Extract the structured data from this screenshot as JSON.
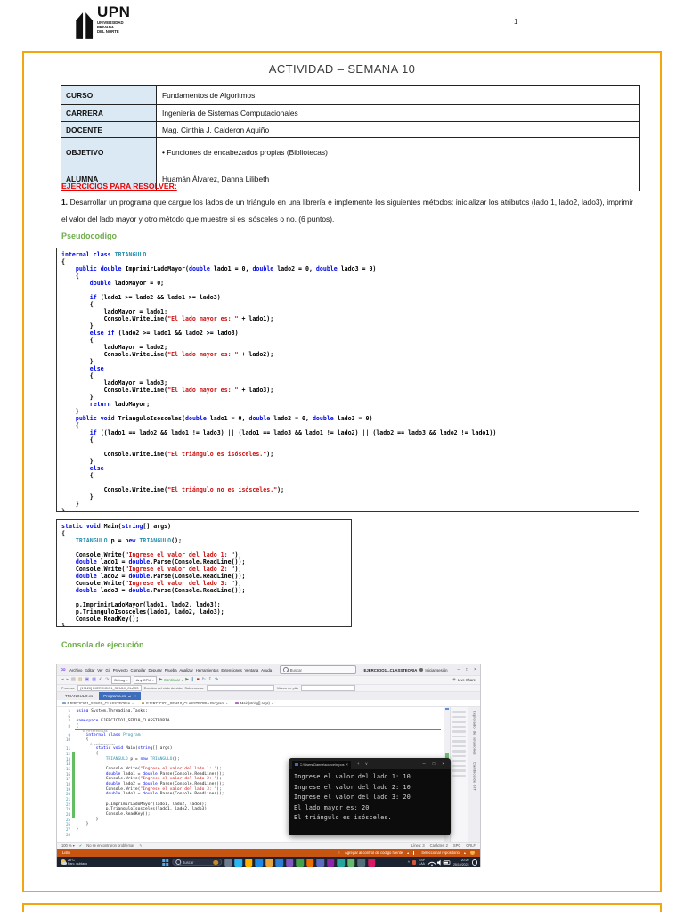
{
  "page": {
    "number": "1",
    "logo_brand": "UPN",
    "logo_sub": [
      "UNIVERSIDAD",
      "PRIVADA",
      "DEL NORTE"
    ],
    "title": "ACTIVIDAD – SEMANA 10"
  },
  "info_table": [
    {
      "label": "CURSO",
      "value": "Fundamentos de Algoritmos"
    },
    {
      "label": "CARRERA",
      "value": "Ingeniería de Sistemas Computacionales"
    },
    {
      "label": "DOCENTE",
      "value": "Mag. Cinthia J. Calderon Aquiño"
    },
    {
      "label": "OBJETIVO",
      "value": "• Funciones de encabezados propias (Bibliotecas)"
    },
    {
      "label": "ALUMNA",
      "value": "Huamán Álvarez, Danna Lilibeth"
    }
  ],
  "exercises": {
    "heading": "EJERCICIOS PARA RESOLVER:",
    "item_number": "1.",
    "item_text": " Desarrollar un programa que cargue los lados de un triángulo en una librería e implemente los siguientes métodos: inicializar los atributos (lado 1, lado2, lado3), imprimir el valor del lado mayor y otro método que muestre si es isósceles o no. (6 puntos)."
  },
  "sections": {
    "pseudocode_heading": "Pseudocodigo",
    "console_heading": "Consola de ejecución"
  },
  "code_block_1": [
    "internal class TRIANGULO",
    "{",
    "    public double ImprimirLadoMayor(double lado1 = 0, double lado2 = 0, double lado3 = 0)",
    "    {",
    "        double ladoMayor = 0;",
    "",
    "        if (lado1 >= lado2 && lado1 >= lado3)",
    "        {",
    "            ladoMayor = lado1;",
    "            Console.WriteLine(\"El lado mayor es: \" + lado1);",
    "        }",
    "        else if (lado2 >= lado1 && lado2 >= lado3)",
    "        {",
    "            ladoMayor = lado2;",
    "            Console.WriteLine(\"El lado mayor es: \" + lado2);",
    "        }",
    "        else",
    "        {",
    "            ladoMayor = lado3;",
    "            Console.WriteLine(\"El lado mayor es: \" + lado3);",
    "        }",
    "        return ladoMayor;",
    "    }",
    "    public void TrianguloIsosceles(double lado1 = 0, double lado2 = 0, double lado3 = 0)",
    "    {",
    "        if ((lado1 == lado2 && lado1 != lado3) || (lado1 == lado3 && lado1 != lado2) || (lado2 == lado3 && lado2 != lado1))",
    "        {",
    "",
    "            Console.WriteLine(\"El triángulo es isósceles.\");",
    "        }",
    "        else",
    "        {",
    "",
    "            Console.WriteLine(\"El triángulo no es isósceles.\");",
    "        }",
    "    }",
    "}"
  ],
  "code_block_2": [
    "static void Main(string[] args)",
    "{",
    "    TRIANGULO p = new TRIANGULO();",
    "",
    "    Console.Write(\"Ingrese el valor del lado 1: \");",
    "    double lado1 = double.Parse(Console.ReadLine());",
    "    Console.Write(\"Ingrese el valor del lado 2: \");",
    "    double lado2 = double.Parse(Console.ReadLine());",
    "    Console.Write(\"Ingrese el valor del lado 3: \");",
    "    double lado3 = double.Parse(Console.ReadLine());",
    "",
    "    p.ImprimirLadoMayor(lado1, lado2, lado3);",
    "    p.TrianguloIsosceles(lado1, lado2, lado3);",
    "    Console.ReadKey();",
    "}"
  ],
  "vs": {
    "menus": [
      "Archivo",
      "Editar",
      "Ver",
      "Git",
      "Proyecto",
      "Compilar",
      "Depurar",
      "Prueba",
      "Analizar",
      "Herramientas",
      "Extensiones",
      "Ventana",
      "Ayuda"
    ],
    "search_label": "Buscar",
    "solution_name": "EJERCICIO1...CLASSTEORIA",
    "sign_in": "Iniciar sesión",
    "toolbar": {
      "icons_left": [
        {
          "name": "navigate-back",
          "g": "◂",
          "c": "#8A8A92"
        },
        {
          "name": "navigate-forward",
          "g": "▸",
          "c": "#8A8A92"
        },
        {
          "name": "new-file",
          "g": "▤",
          "c": "#8A8A92"
        },
        {
          "name": "open-file",
          "g": "▥",
          "c": "#C8A254"
        },
        {
          "name": "save",
          "g": "▣",
          "c": "#7A6FF0"
        },
        {
          "name": "save-all",
          "g": "▦",
          "c": "#7A6FF0"
        },
        {
          "name": "undo",
          "g": "↶",
          "c": "#8A8A92"
        },
        {
          "name": "redo",
          "g": "↷",
          "c": "#8A8A92"
        }
      ],
      "debug_target": "Debug",
      "platform": "Any CPU",
      "continue_label": "Continuar",
      "icons_run": [
        {
          "name": "continue-play",
          "g": "▶",
          "c": "#3F9E44"
        },
        {
          "name": "break-all",
          "g": "∥",
          "c": "#3E79B4"
        },
        {
          "name": "stop-debug",
          "g": "■",
          "c": "#C0392B"
        },
        {
          "name": "restart",
          "g": "↻",
          "c": "#3E79B4"
        },
        {
          "name": "step-into",
          "g": "↧",
          "c": "#3E79B4"
        },
        {
          "name": "step-over",
          "g": "↷",
          "c": "#3E79B4"
        }
      ],
      "live_share": "Live Share"
    },
    "process_row": {
      "process_label": "Proceso:",
      "process_value": "[17120] EJERCICIO1_SEM10_CLASS",
      "lifecycle": "Eventos del ciclo de vida",
      "thread_label": "Subproceso:",
      "stack_label": "Marco de pila"
    },
    "tabs": [
      {
        "label": "TRIANGULO.cs",
        "active": false
      },
      {
        "label": "Programa.cs",
        "active": true
      }
    ],
    "breadcrumbs": [
      "EJERCICIO1_SEM10_CLASSTEORIA",
      "EJERCICIO1_SEM10_CLASSTEORIA.Program",
      "Main(string[] args)"
    ],
    "editor_lines": [
      {
        "n": "5",
        "c": "using System.Threading.Tasks;"
      },
      {
        "n": "6",
        "c": ""
      },
      {
        "n": "7",
        "c": "namespace EJERCICIO1_SEM10_CLASSTEORIA"
      },
      {
        "n": "8",
        "c": "{"
      },
      {
        "ref": "    0 referencias"
      },
      {
        "n": "9",
        "c": "    internal class Program"
      },
      {
        "n": "10",
        "c": "    {"
      },
      {
        "ref": "        0 referencias"
      },
      {
        "n": "11",
        "c": "        static void Main(string[] args)"
      },
      {
        "n": "12",
        "c": "        {",
        "g": true
      },
      {
        "n": "13",
        "c": "            TRIANGULO p = new TRIANGULO();",
        "g": true
      },
      {
        "n": "14",
        "c": "",
        "g": true
      },
      {
        "n": "15",
        "c": "            Console.Write(\"Ingrese el valor del lado 1: \");",
        "g": true
      },
      {
        "n": "16",
        "c": "            double lado1 = double.Parse(Console.ReadLine());",
        "g": true
      },
      {
        "n": "17",
        "c": "            Console.Write(\"Ingrese el valor del lado 2: \");",
        "g": true
      },
      {
        "n": "18",
        "c": "            double lado2 = double.Parse(Console.ReadLine());",
        "g": true
      },
      {
        "n": "19",
        "c": "            Console.Write(\"Ingrese el valor del lado 3: \");",
        "g": true
      },
      {
        "n": "20",
        "c": "            double lado3 = double.Parse(Console.ReadLine());",
        "g": true
      },
      {
        "n": "21",
        "c": "",
        "g": true
      },
      {
        "n": "22",
        "c": "            p.ImprimirLadoMayor(lado1, lado2, lado3);",
        "g": true
      },
      {
        "n": "23",
        "c": "            p.TrianguloIsosceles(lado1, lado2, lado3);",
        "g": true
      },
      {
        "n": "24",
        "c": "            Console.ReadKey();",
        "g": true
      },
      {
        "n": "25",
        "c": "        }"
      },
      {
        "n": "26",
        "c": "    }"
      },
      {
        "n": "27",
        "c": "}"
      },
      {
        "n": "28",
        "c": ""
      }
    ],
    "side_tabs": [
      "Explorador de soluciones",
      "Cambios de GIT"
    ],
    "console_window": {
      "title": "C:\\Users\\Danna\\source\\repos",
      "lines": [
        "Ingrese el valor del lado 1: 10",
        "Ingrese el valor del lado 2: 10",
        "Ingrese el valor del lado 3: 20",
        "El lado mayor es: 20",
        "El triángulo es isósceles."
      ]
    },
    "status_bar": {
      "zoom": "100 %",
      "message": "No se encontraron problemas",
      "line": "Línea: 3",
      "col": "Carácter: 2",
      "spc": "SPC",
      "eol": "CRLF"
    },
    "git_bar": {
      "ready": "Listo",
      "add_scc": "Agregar al control de código fuente",
      "select_repo": "Seleccionar repositorio"
    },
    "taskbar": {
      "weather_temp": "26°C",
      "weather_desc": "Parc. nublado",
      "search": "Buscar",
      "apps": [
        {
          "c": "#6E7B8E"
        },
        {
          "c": "#29B6F6"
        },
        {
          "c": "#FFB300",
          "r": true
        },
        {
          "c": "#1E88E5"
        },
        {
          "c": "#E8A33D"
        },
        {
          "c": "#2D7DD2"
        },
        {
          "c": "#7E57C2",
          "r": true
        },
        {
          "c": "#43A047"
        },
        {
          "c": "#EF6C00"
        },
        {
          "c": "#5C6BC0"
        },
        {
          "c": "#8E24AA",
          "r": true
        },
        {
          "c": "#26A69A"
        },
        {
          "c": "#66BB6A"
        },
        {
          "c": "#546E7A"
        },
        {
          "c": "#D81B60"
        }
      ],
      "tray_lang_1": "ESP",
      "tray_lang_2": "LAA",
      "time": "20:20",
      "date": "25/10/2023"
    }
  }
}
